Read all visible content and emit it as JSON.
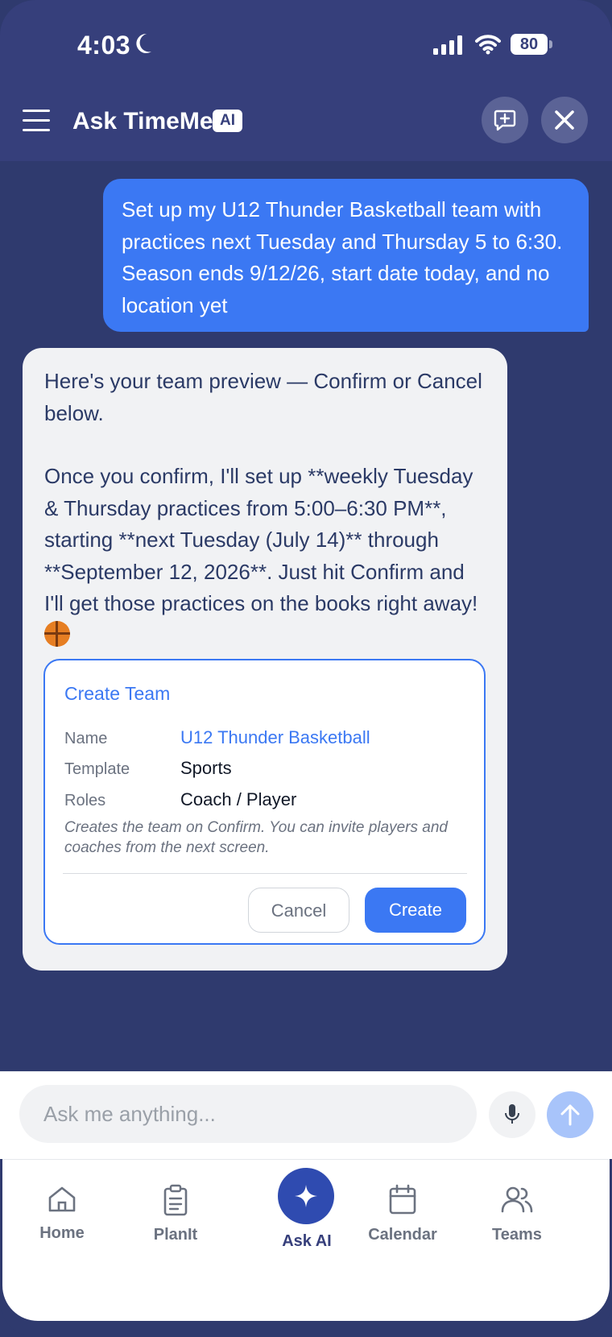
{
  "status_bar": {
    "time": "4:03",
    "battery": "80"
  },
  "header": {
    "title": "Ask TimeMe",
    "badge": "AI"
  },
  "chat": {
    "user_message": "Set up my U12 Thunder Basketball team with practices next Tuesday and Thursday 5 to 6:30. Season ends 9/12/26, start date today, and no location yet",
    "bot_message_line1": "Here's your team preview — Confirm or Cancel below.",
    "bot_message_line2": "Once you confirm, I'll set up **weekly Tuesday & Thursday practices from 5:00–6:30 PM**, starting **next Tuesday (July 14)** through **September 12, 2026**. Just hit Confirm and I'll get those practices on the books right away!",
    "emoji": "basketball"
  },
  "team_card": {
    "title": "Create Team",
    "fields": [
      {
        "label": "Name",
        "value": "U12 Thunder Basketball"
      },
      {
        "label": "Template",
        "value": "Sports"
      },
      {
        "label": "Roles",
        "value": "Coach / Player"
      }
    ],
    "note": "Creates the team on Confirm. You can invite players and coaches from the next screen.",
    "cancel_label": "Cancel",
    "create_label": "Create"
  },
  "composer": {
    "placeholder": "Ask me anything..."
  },
  "tabs": [
    {
      "label": "Home",
      "icon": "home-icon"
    },
    {
      "label": "PlanIt",
      "icon": "clipboard-icon"
    },
    {
      "label": "Ask AI",
      "icon": "sparkle-icon"
    },
    {
      "label": "Calendar",
      "icon": "calendar-icon"
    },
    {
      "label": "Teams",
      "icon": "users-icon"
    }
  ],
  "colors": {
    "header": "#363f7b",
    "accent": "#3b78f3",
    "ask_ai": "#2f4bb0"
  }
}
